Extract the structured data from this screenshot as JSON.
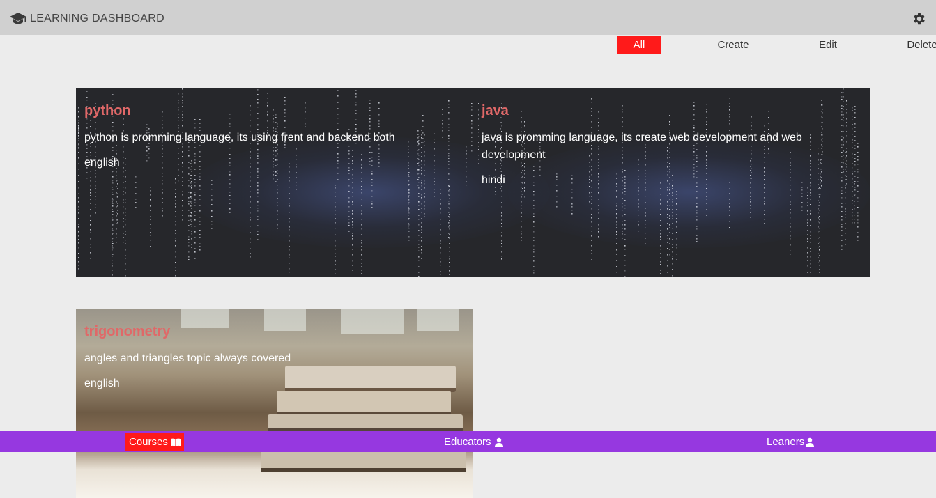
{
  "header": {
    "title": "LEARNING DASHBOARD",
    "logo_icon": "graduation-cap-icon",
    "settings_icon": "gear-icon"
  },
  "tabs": [
    {
      "label": "All",
      "active": true
    },
    {
      "label": "Create",
      "active": false
    },
    {
      "label": "Edit",
      "active": false
    },
    {
      "label": "Delete",
      "active": false
    }
  ],
  "courses": [
    {
      "title": "python",
      "description": "python is promming language, its using frent and backend both",
      "language": "english"
    },
    {
      "title": "java",
      "description": "java is promming language, its create web development and web development",
      "language": "hindi"
    },
    {
      "title": "trigonometry",
      "description": "angles and triangles topic always covered",
      "language": "english"
    }
  ],
  "bottom_nav": [
    {
      "label": "Courses",
      "icon": "book-icon",
      "active": true
    },
    {
      "label": "Educators",
      "icon": "user-icon",
      "active": false
    },
    {
      "label": "Leaners",
      "icon": "user-icon",
      "active": false
    }
  ],
  "colors": {
    "accent_red": "#ff1a1a",
    "bottom_bar": "#9638e0",
    "course_title": "#e06868",
    "top_bar": "#d0d0d0"
  }
}
